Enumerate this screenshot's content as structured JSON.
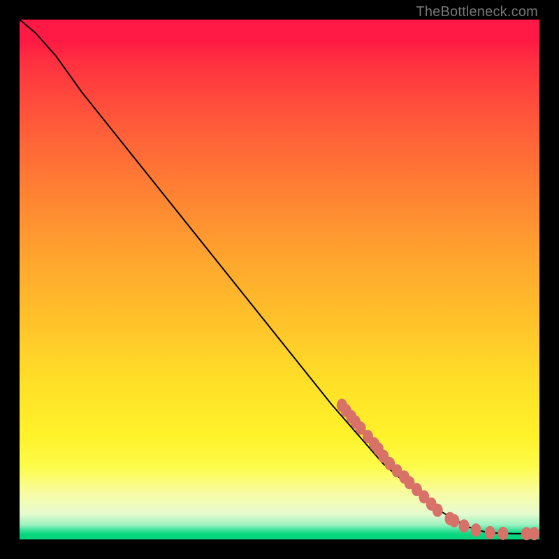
{
  "attribution": "TheBottleneck.com",
  "chart_data": {
    "type": "line",
    "title": "",
    "xlabel": "",
    "ylabel": "",
    "xlim": [
      0,
      100
    ],
    "ylim": [
      0,
      100
    ],
    "grid": false,
    "legend": false,
    "curve_points": [
      {
        "x": 0,
        "y": 100
      },
      {
        "x": 3,
        "y": 97.5
      },
      {
        "x": 7,
        "y": 93
      },
      {
        "x": 12,
        "y": 86
      },
      {
        "x": 20,
        "y": 76
      },
      {
        "x": 30,
        "y": 63.5
      },
      {
        "x": 40,
        "y": 51
      },
      {
        "x": 50,
        "y": 38.5
      },
      {
        "x": 60,
        "y": 26
      },
      {
        "x": 70,
        "y": 14.5
      },
      {
        "x": 80,
        "y": 6
      },
      {
        "x": 86,
        "y": 2.5
      },
      {
        "x": 90,
        "y": 1.3
      },
      {
        "x": 95,
        "y": 1.1
      },
      {
        "x": 100,
        "y": 1.1
      }
    ],
    "markers": [
      {
        "x": 62.0,
        "y": 25.8
      },
      {
        "x": 62.8,
        "y": 24.8
      },
      {
        "x": 63.8,
        "y": 23.6
      },
      {
        "x": 64.6,
        "y": 22.6
      },
      {
        "x": 65.6,
        "y": 21.4
      },
      {
        "x": 67.0,
        "y": 19.8
      },
      {
        "x": 68.2,
        "y": 18.4
      },
      {
        "x": 69.0,
        "y": 17.4
      },
      {
        "x": 70.0,
        "y": 16.0
      },
      {
        "x": 71.2,
        "y": 14.6
      },
      {
        "x": 72.6,
        "y": 13.2
      },
      {
        "x": 74.0,
        "y": 12.0
      },
      {
        "x": 75.0,
        "y": 10.9
      },
      {
        "x": 76.4,
        "y": 9.6
      },
      {
        "x": 77.8,
        "y": 8.2
      },
      {
        "x": 79.2,
        "y": 6.8
      },
      {
        "x": 80.4,
        "y": 5.6
      },
      {
        "x": 82.8,
        "y": 4.0
      },
      {
        "x": 83.6,
        "y": 3.6
      },
      {
        "x": 85.5,
        "y": 2.6
      },
      {
        "x": 87.8,
        "y": 1.8
      },
      {
        "x": 90.5,
        "y": 1.3
      },
      {
        "x": 93.0,
        "y": 1.15
      },
      {
        "x": 97.5,
        "y": 1.1
      },
      {
        "x": 99.0,
        "y": 1.1
      }
    ]
  }
}
